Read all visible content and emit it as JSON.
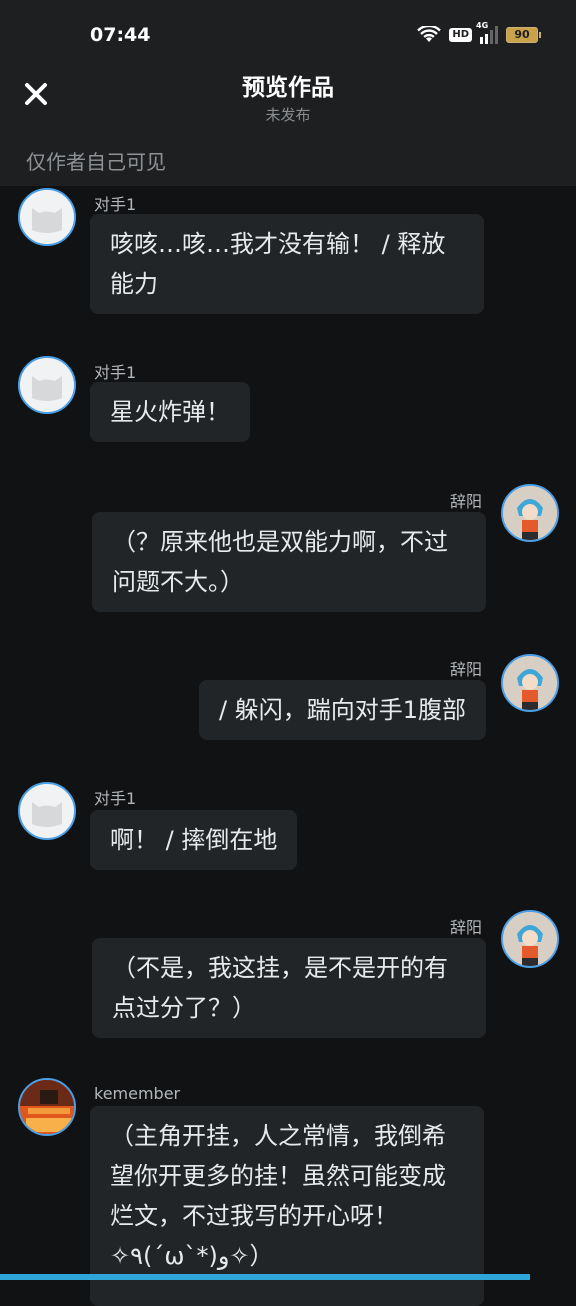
{
  "status": {
    "time": "07:44",
    "hd": "HD",
    "network": "4G",
    "battery": "90"
  },
  "header": {
    "title": "预览作品",
    "subtitle": "未发布",
    "visibility_note": "仅作者自己可见",
    "close_icon": "close-icon"
  },
  "messages": [
    {
      "side": "left",
      "name": "对手1",
      "text": "咳咳…咳…我才没有输！ / 释放能力",
      "avatar": "default-cat-avatar"
    },
    {
      "side": "left",
      "name": "对手1",
      "text": "星火炸弹！",
      "avatar": "default-cat-avatar"
    },
    {
      "side": "right",
      "name": "辞阳",
      "text": "（？原来他也是双能力啊，不过问题不大。）",
      "avatar": "character-avatar"
    },
    {
      "side": "right",
      "name": "辞阳",
      "text": "/ 躲闪，踹向对手1腹部",
      "avatar": "character-avatar"
    },
    {
      "side": "left",
      "name": "对手1",
      "text": "啊！ / 摔倒在地",
      "avatar": "default-cat-avatar"
    },
    {
      "side": "right",
      "name": "辞阳",
      "text": "（不是，我这挂，是不是开的有点过分了？）",
      "avatar": "character-avatar"
    },
    {
      "side": "left",
      "name": "kemember",
      "text": "（主角开挂，人之常情，我倒希望你开更多的挂！虽然可能变成烂文，不过我写的开心呀！✧٩(ˊωˋ*)و✧）",
      "avatar": "photo-avatar"
    }
  ]
}
